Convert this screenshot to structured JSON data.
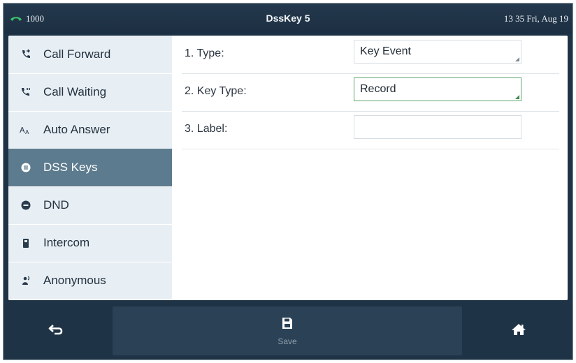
{
  "header": {
    "account": "1000",
    "account_icon": "phone-icon",
    "title": "DssKey 5",
    "clock": "13 35 Fri, Aug 19"
  },
  "sidebar": {
    "items": [
      {
        "label": "Call Forward",
        "icon": "call-forward-icon"
      },
      {
        "label": "Call Waiting",
        "icon": "call-waiting-icon"
      },
      {
        "label": "Auto Answer",
        "icon": "auto-answer-icon"
      },
      {
        "label": "DSS Keys",
        "icon": "dss-keys-icon",
        "active": true
      },
      {
        "label": "DND",
        "icon": "dnd-icon"
      },
      {
        "label": "Intercom",
        "icon": "intercom-icon"
      },
      {
        "label": "Anonymous",
        "icon": "anonymous-icon"
      }
    ]
  },
  "form": {
    "rows": [
      {
        "label": "1. Type:",
        "value": "Key Event"
      },
      {
        "label": "2. Key Type:",
        "value": "Record"
      },
      {
        "label": "3. Label:",
        "value": ""
      }
    ]
  },
  "softkeys": {
    "back_icon": "back-arrow-icon",
    "save_label": "Save",
    "save_icon": "save-icon",
    "home_icon": "home-icon"
  },
  "colors": {
    "frame": "#1f3346",
    "sidebar_bg": "#e8eff4",
    "sidebar_active": "#5d7b8e",
    "focus_border": "#5fa46e",
    "phone_icon": "#3dbf6a"
  }
}
